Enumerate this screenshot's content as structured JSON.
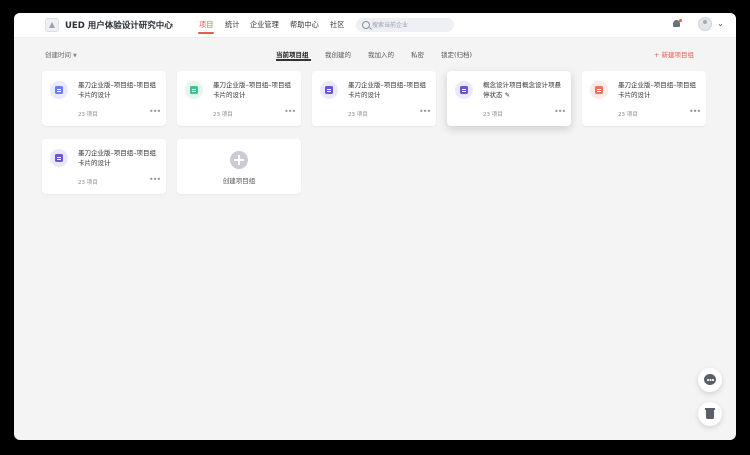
{
  "header": {
    "workspace": "UED 用户体验设计研究中心",
    "nav": [
      {
        "label": "项目",
        "active": true
      },
      {
        "label": "统计",
        "active": false
      },
      {
        "label": "企业管理",
        "active": false
      },
      {
        "label": "帮助中心",
        "active": false
      },
      {
        "label": "社区",
        "active": false
      }
    ],
    "search_placeholder": "搜索当前企业"
  },
  "toolbar": {
    "sort_label": "创建时间",
    "tabs": [
      {
        "label": "当前项目组",
        "active": true
      },
      {
        "label": "我创建的",
        "active": false
      },
      {
        "label": "我加入的",
        "active": false
      },
      {
        "label": "私密",
        "active": false
      },
      {
        "label": "锁定(归档)",
        "active": false
      }
    ],
    "new_group_label": "新建项目组"
  },
  "cards": [
    {
      "title": "墨刀企业版–项目组–项目组卡片的设计",
      "count": "23 项目",
      "color": "#6b7cf2",
      "bg": "#e8ebfd"
    },
    {
      "title": "墨刀企业版–项目组–项目组卡片的设计",
      "count": "23 项目",
      "color": "#3ec48a",
      "bg": "#e3f7ee"
    },
    {
      "title": "墨刀企业版–项目组–项目组卡片的设计",
      "count": "23 项目",
      "color": "#6a57d8",
      "bg": "#ebe8fb"
    },
    {
      "title": "概念设计项目概念设计项悬停状态 ✎",
      "count": "23 项目",
      "color": "#6a57d8",
      "bg": "#ebe8fb"
    },
    {
      "title": "墨刀企业版–项目组–项目组卡片的设计",
      "count": "23 项目",
      "color": "#f0735c",
      "bg": "#fde9e5"
    },
    {
      "title": "墨刀企业版–项目组–项目组卡片的设计",
      "count": "23 项目",
      "color": "#6a57d8",
      "bg": "#ebe8fb"
    }
  ],
  "create_label": "创建项目组",
  "more_label": "•••"
}
